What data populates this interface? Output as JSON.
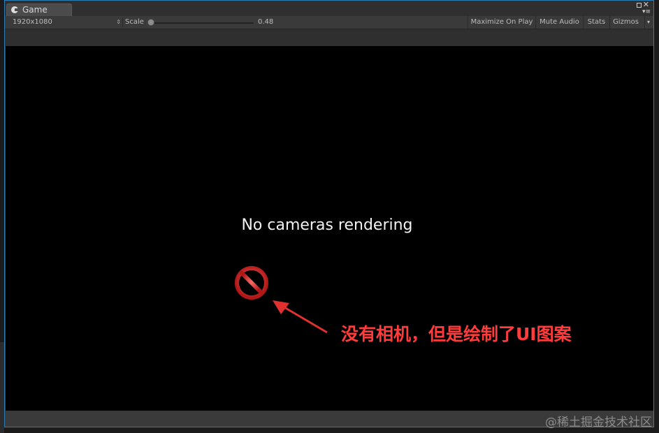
{
  "window": {
    "tab_label": "Game",
    "tab_icon": "unity-game-icon"
  },
  "toolbar": {
    "resolution": "1920x1080",
    "scale_label": "Scale",
    "scale_value": "0.48",
    "scale_fraction": 0.02,
    "maximize_label": "Maximize On Play",
    "mute_label": "Mute Audio",
    "stats_label": "Stats",
    "gizmos_label": "Gizmos"
  },
  "viewport": {
    "message": "No cameras rendering",
    "background": "#000000"
  },
  "annotation": {
    "text": "没有相机，但是绘制了UI图案",
    "color": "#ff3b3b"
  },
  "watermark": "@稀土掘金技术社区"
}
